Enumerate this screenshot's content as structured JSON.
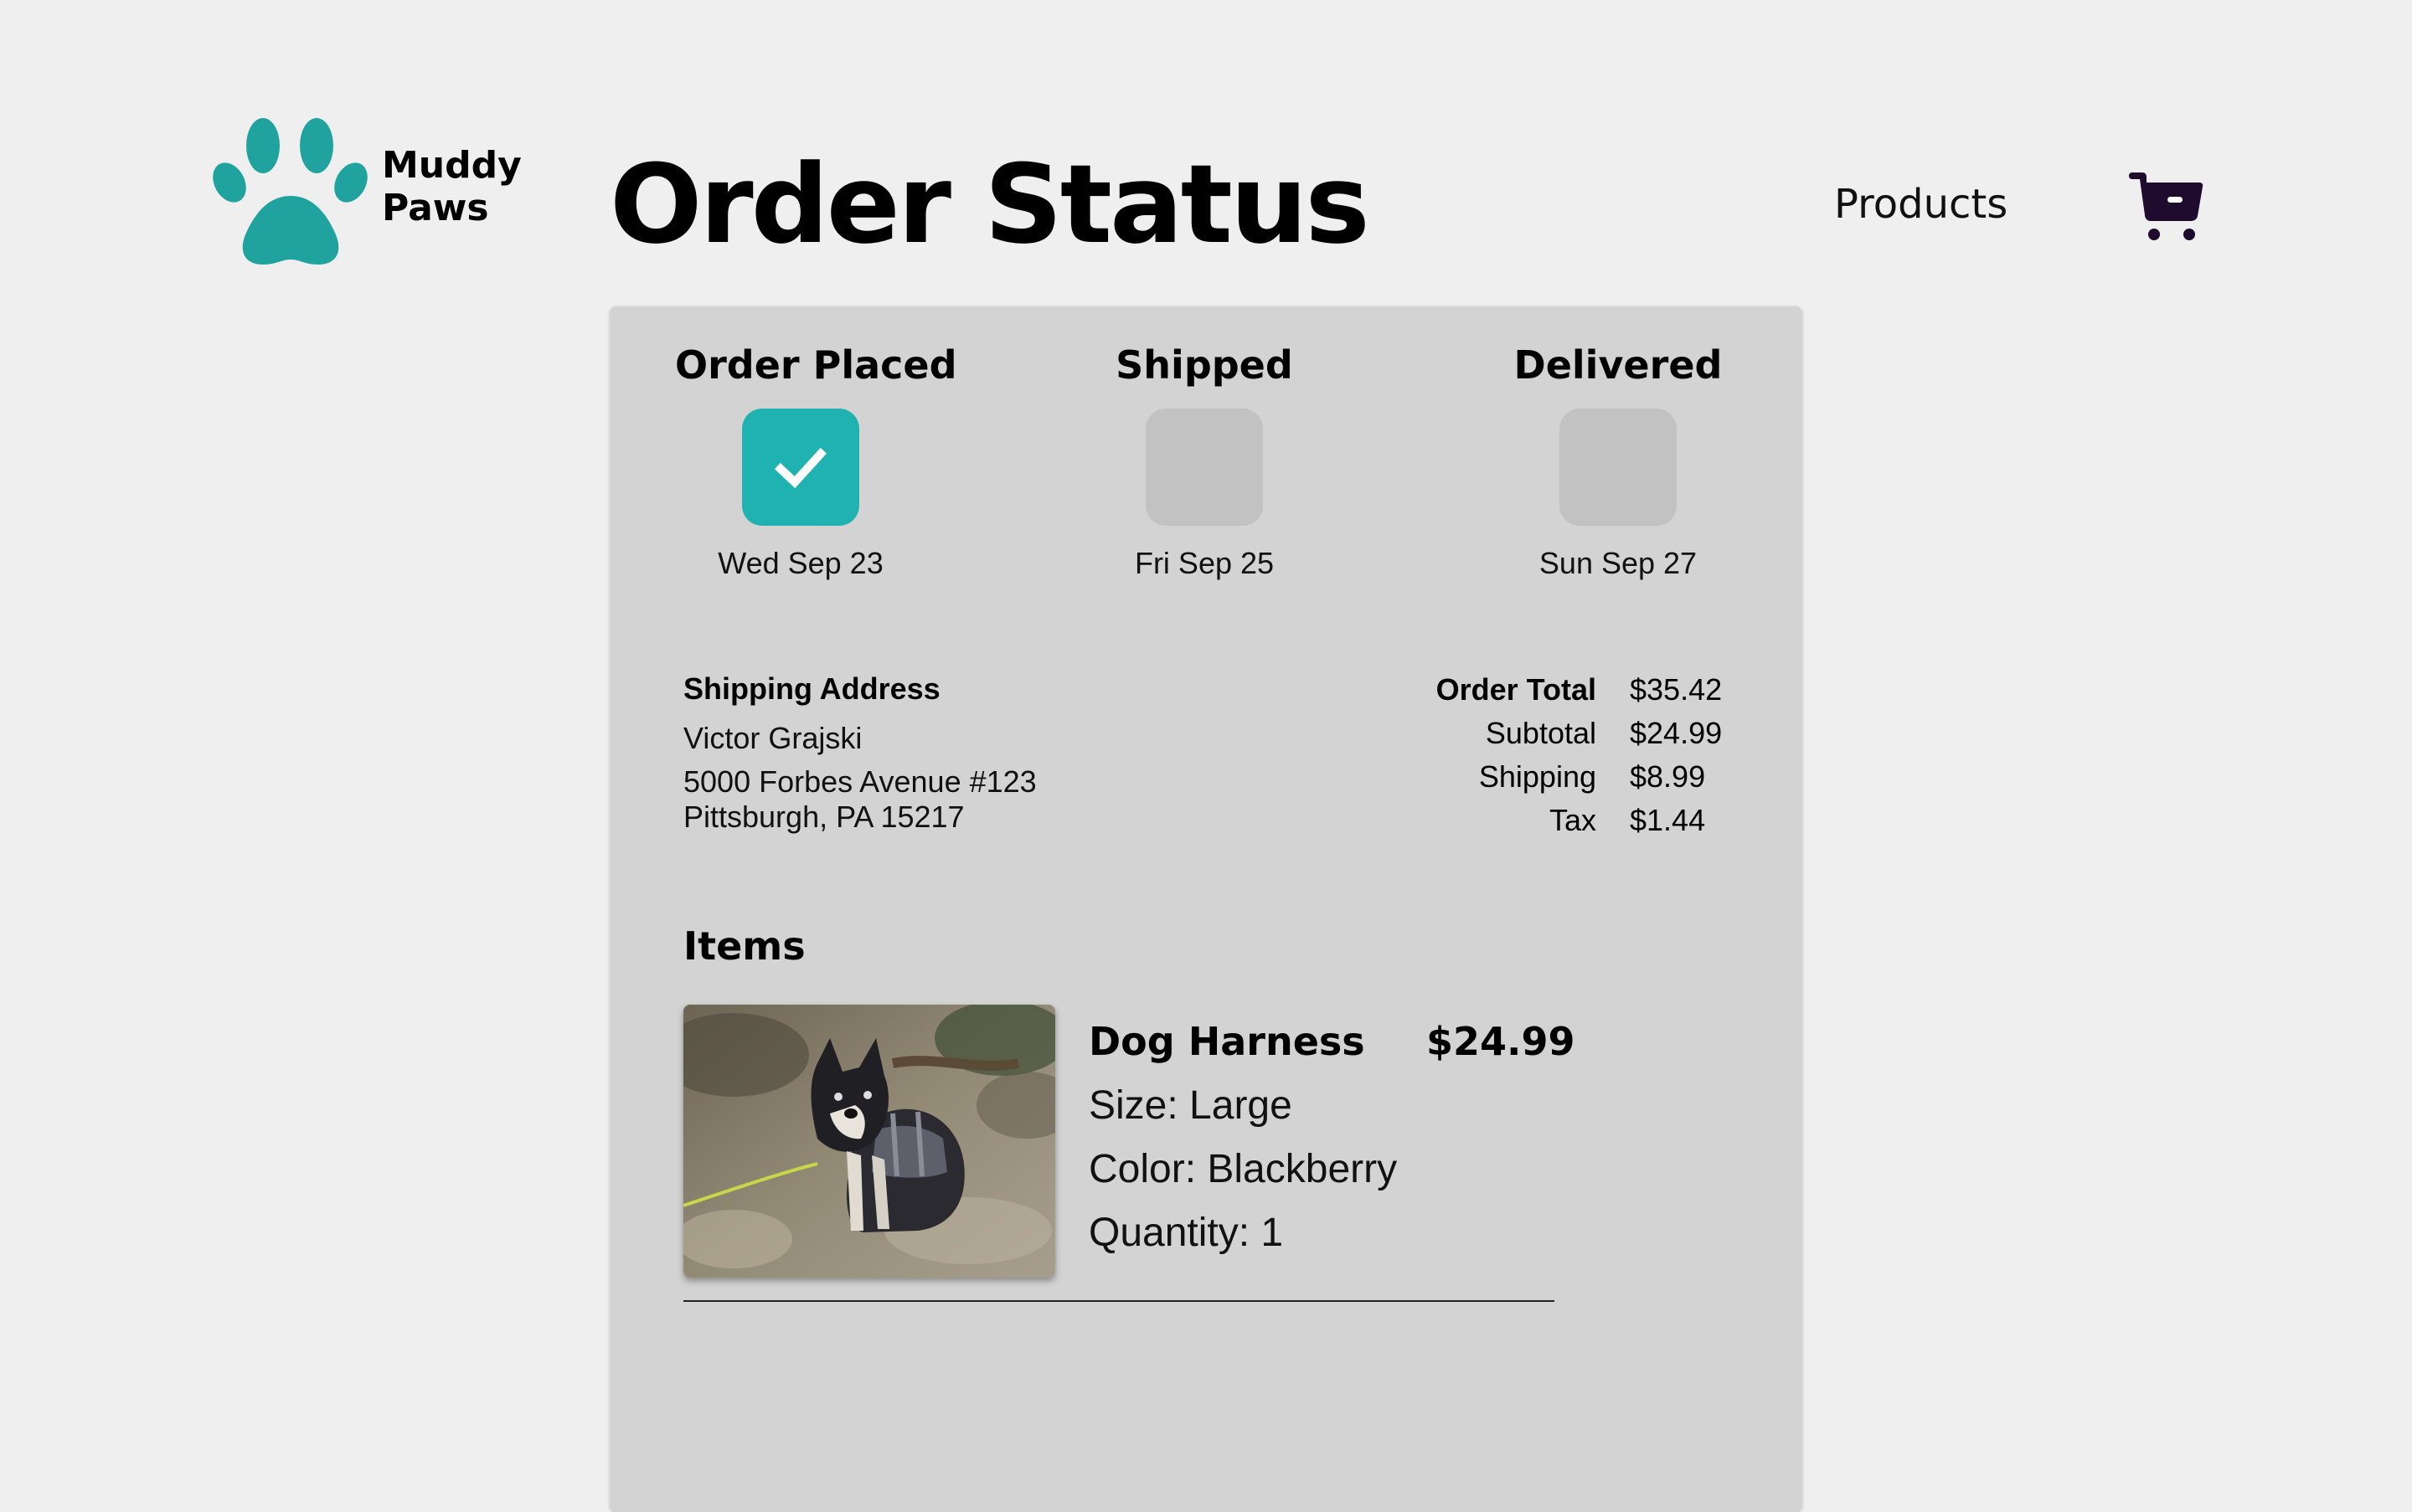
{
  "brand": {
    "line1": "Muddy",
    "line2": "Paws",
    "logo_icon": "paw-icon",
    "logo_color": "#20a39f"
  },
  "page": {
    "title": "Order Status"
  },
  "nav": {
    "products_label": "Products",
    "cart_icon": "cart-icon",
    "cart_color": "#1e0b2e"
  },
  "status": {
    "steps": [
      {
        "label": "Order Placed",
        "date": "Wed Sep 23",
        "completed": true
      },
      {
        "label": "Shipped",
        "date": "Fri Sep 25",
        "completed": false
      },
      {
        "label": "Delivered",
        "date": "Sun Sep 27",
        "completed": false
      }
    ],
    "completed_color": "#20b2b0",
    "pending_color": "#c2c2c2",
    "check_icon": "check-icon"
  },
  "shipping": {
    "heading": "Shipping Address",
    "name": "Victor Grajski",
    "street": "5000 Forbes Avenue #123",
    "city": "Pittsburgh, PA 15217"
  },
  "totals": {
    "order_total_label": "Order Total",
    "order_total_value": "$35.42",
    "subtotal_label": "Subtotal",
    "subtotal_value": "$24.99",
    "shipping_label": "Shipping",
    "shipping_value": "$8.99",
    "tax_label": "Tax",
    "tax_value": "$1.44"
  },
  "items": {
    "heading": "Items",
    "list": [
      {
        "name": "Dog Harness",
        "price": "$24.99",
        "size": "Size: Large",
        "color": "Color: Blackberry",
        "quantity": "Quantity: 1",
        "image": "dog-harness-photo"
      }
    ]
  }
}
